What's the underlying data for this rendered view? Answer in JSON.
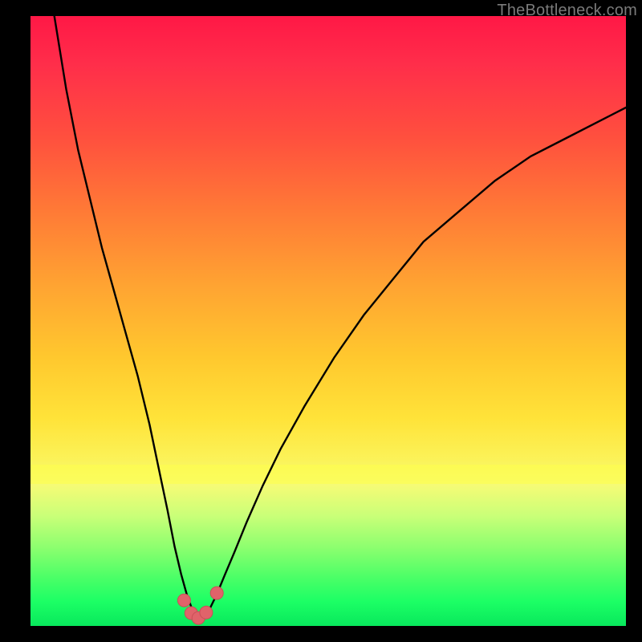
{
  "watermark": "TheBottleneck.com",
  "colors": {
    "frame_bg": "#000000",
    "curve_stroke": "#000000",
    "dot_fill": "#e0636a",
    "dot_stroke": "#c94f57",
    "gradient_top": "#ff1846",
    "gradient_bottom": "#08e85c"
  },
  "chart_data": {
    "type": "line",
    "title": "",
    "xlabel": "",
    "ylabel": "",
    "xlim": [
      0,
      100
    ],
    "ylim": [
      0,
      100
    ],
    "grid": false,
    "legend": false,
    "note": "Axes are not labeled in the source image; values are percent-of-plot estimates read from pixel positions. Low y ≈ green/good, high y ≈ red/bottleneck.",
    "series": [
      {
        "name": "bottleneck-curve",
        "x": [
          4,
          6,
          8,
          10,
          12,
          14,
          16,
          18,
          20,
          21.5,
          23,
          24.2,
          25.3,
          26.3,
          27.2,
          27.8,
          28.4,
          29.2,
          30.2,
          31.3,
          32.6,
          34.2,
          36.3,
          39,
          42,
          46,
          51,
          56,
          61,
          66,
          72,
          78,
          84,
          90,
          96,
          100
        ],
        "y": [
          100,
          88,
          78,
          70,
          62,
          55,
          48,
          41,
          33,
          26,
          19,
          13,
          8.5,
          5,
          2.6,
          1.4,
          1.2,
          1.6,
          3.0,
          5.2,
          8.3,
          12,
          17,
          23,
          29,
          36,
          44,
          51,
          57,
          63,
          68,
          73,
          77,
          80,
          83,
          85
        ]
      }
    ],
    "markers": [
      {
        "x": 25.8,
        "y": 4.2
      },
      {
        "x": 27.0,
        "y": 2.1
      },
      {
        "x": 28.2,
        "y": 1.3
      },
      {
        "x": 29.5,
        "y": 2.2
      },
      {
        "x": 31.3,
        "y": 5.4
      }
    ]
  }
}
